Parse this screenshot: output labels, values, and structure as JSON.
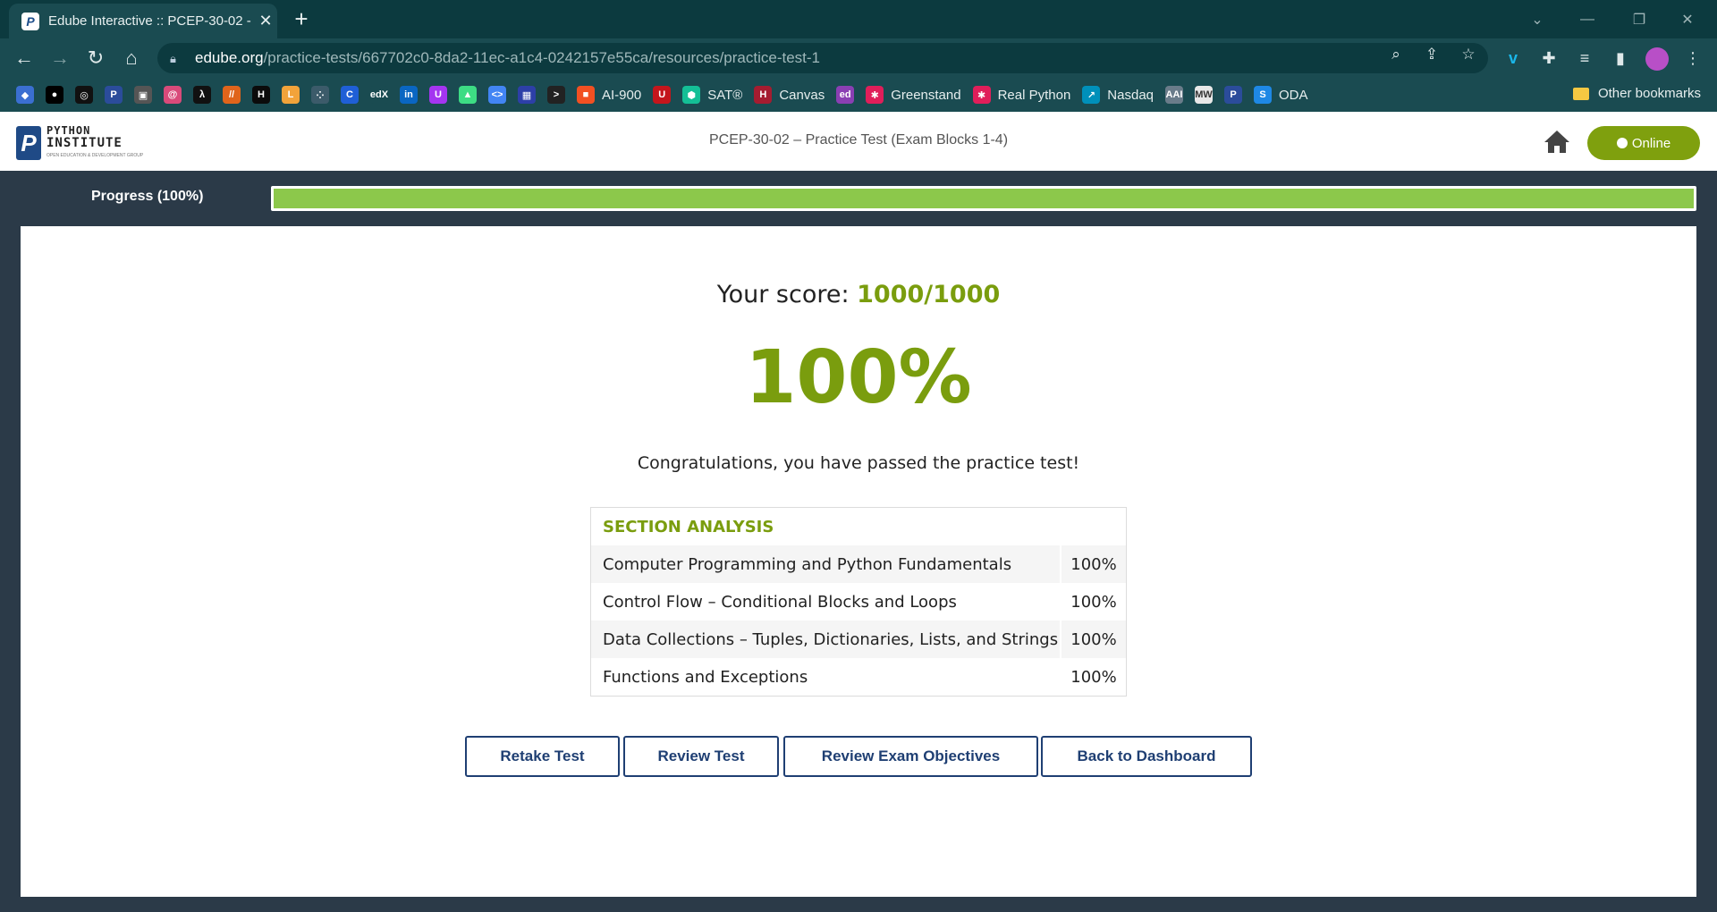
{
  "browser": {
    "tab_title": "Edube Interactive :: PCEP-30-02 -",
    "tab_favicon": "P",
    "url_host": "edube.org",
    "url_path": "/practice-tests/667702c0-8da2-11ec-a1c4-0242157e55ca/resources/practice-test-1"
  },
  "bookmarks": [
    {
      "icon": "layers-icon",
      "glyph": "◆",
      "color": "#3b6fd1",
      "label": ""
    },
    {
      "icon": "github-icon",
      "glyph": "●",
      "color": "#000000",
      "label": ""
    },
    {
      "icon": "target-icon",
      "glyph": "◎",
      "color": "#111111",
      "label": ""
    },
    {
      "icon": "python-institute-icon",
      "glyph": "P",
      "color": "#2b4c9b",
      "label": ""
    },
    {
      "icon": "printer-icon",
      "glyph": "▣",
      "color": "#555555",
      "label": ""
    },
    {
      "icon": "swirl-icon",
      "glyph": "@",
      "color": "#d94a7a",
      "label": ""
    },
    {
      "icon": "lambda-icon",
      "glyph": "λ",
      "color": "#111111",
      "label": ""
    },
    {
      "icon": "stripes-icon",
      "glyph": "//",
      "color": "#e0641b",
      "label": ""
    },
    {
      "icon": "hackerrank-icon",
      "glyph": "H",
      "color": "#0b0b0b",
      "label": ""
    },
    {
      "icon": "leetcode-icon",
      "glyph": "L",
      "color": "#f2a33a",
      "label": ""
    },
    {
      "icon": "dots-icon",
      "glyph": "⁘",
      "color": "#3c5b6a",
      "label": ""
    },
    {
      "icon": "coursera-icon",
      "glyph": "C",
      "color": "#1f5fd6",
      "label": ""
    },
    {
      "icon": "edx-icon",
      "glyph": "edX",
      "color": "#1a4b51",
      "label": ""
    },
    {
      "icon": "linkedin-icon",
      "glyph": "in",
      "color": "#0a66c2",
      "label": ""
    },
    {
      "icon": "udemy-icon",
      "glyph": "U",
      "color": "#a435f0",
      "label": ""
    },
    {
      "icon": "android-icon",
      "glyph": "▲",
      "color": "#3ddc84",
      "label": ""
    },
    {
      "icon": "code-icon",
      "glyph": "<>",
      "color": "#4285f4",
      "label": ""
    },
    {
      "icon": "grid-icon",
      "glyph": "▦",
      "color": "#2d3fa8",
      "label": ""
    },
    {
      "icon": "terminal-icon",
      "glyph": ">",
      "color": "#222222",
      "label": ""
    },
    {
      "icon": "microsoft-icon",
      "glyph": "■",
      "color": "#f25022",
      "label": "AI-900"
    },
    {
      "icon": "shield-icon",
      "glyph": "U",
      "color": "#c4161c",
      "label": ""
    },
    {
      "icon": "khan-icon",
      "glyph": "⬢",
      "color": "#14bf96",
      "label": "SAT®"
    },
    {
      "icon": "harvard-icon",
      "glyph": "H",
      "color": "#a51c30",
      "label": "Canvas"
    },
    {
      "icon": "ed-icon",
      "glyph": "ed",
      "color": "#8a3fb3",
      "label": ""
    },
    {
      "icon": "slack-icon",
      "glyph": "✱",
      "color": "#e01e5a",
      "label": "Greenstand"
    },
    {
      "icon": "slack-icon",
      "glyph": "✱",
      "color": "#e01e5a",
      "label": "Real Python"
    },
    {
      "icon": "nasdaq-icon",
      "glyph": "↗",
      "color": "#0090ba",
      "label": "Nasdaq"
    },
    {
      "icon": "aai-icon",
      "glyph": "AAI",
      "color": "#6a7c8a",
      "label": ""
    },
    {
      "icon": "mw-icon",
      "glyph": "MW",
      "color": "#e8e8e8",
      "label": ""
    },
    {
      "icon": "python-institute-icon",
      "glyph": "P",
      "color": "#2b4c9b",
      "label": ""
    },
    {
      "icon": "oda-icon",
      "glyph": "S",
      "color": "#1e88e5",
      "label": "ODA"
    }
  ],
  "other_bookmarks": "Other bookmarks",
  "header": {
    "logo_line1": "PYTHON",
    "logo_line2": "INSTITUTE",
    "logo_line3": "OPEN EDUCATION & DEVELOPMENT GROUP",
    "title": "PCEP-30-02 – Practice Test (Exam Blocks 1-4)",
    "online_label": "Online"
  },
  "progress": {
    "label": "Progress (100%)",
    "fraction": 1.0
  },
  "result": {
    "score_prefix": "Your score: ",
    "score_value": "1000/1000",
    "percent": "100%",
    "congrats": "Congratulations, you have passed the practice test!"
  },
  "analysis": {
    "title": "SECTION ANALYSIS",
    "rows": [
      {
        "name": "Computer Programming and Python Fundamentals",
        "pct": "100%"
      },
      {
        "name": "Control Flow – Conditional Blocks and Loops",
        "pct": "100%"
      },
      {
        "name": "Data Collections – Tuples, Dictionaries, Lists, and Strings",
        "pct": "100%"
      },
      {
        "name": "Functions and Exceptions",
        "pct": "100%"
      }
    ]
  },
  "buttons": {
    "retake": "Retake Test",
    "review": "Review Test",
    "objectives": "Review Exam Objectives",
    "dashboard": "Back to Dashboard"
  },
  "colors": {
    "accent_green": "#7a9d0e",
    "progress_green": "#8cc84b",
    "button_navy": "#1f3f73",
    "chrome_teal": "#1a4b51"
  }
}
